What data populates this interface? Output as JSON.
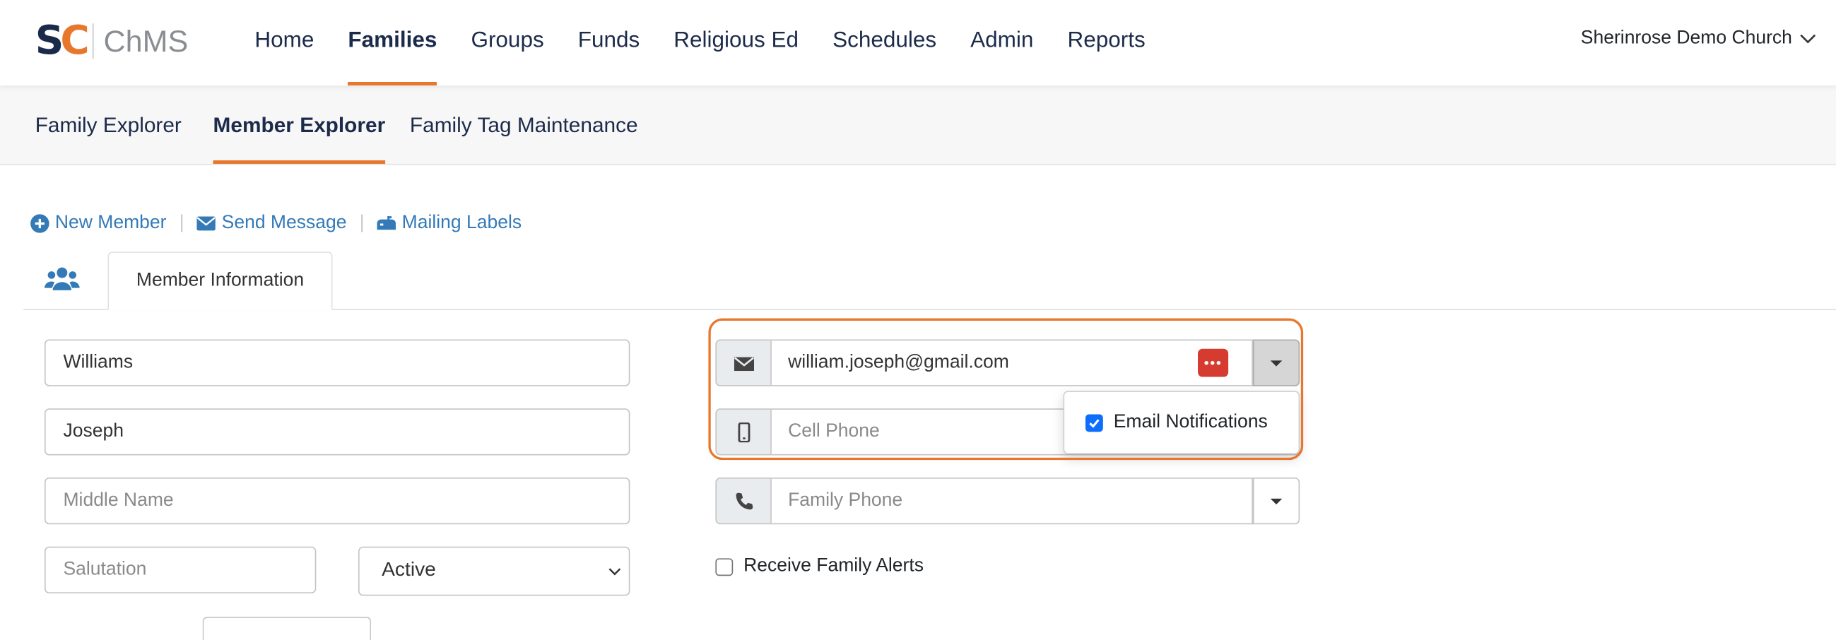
{
  "app": {
    "logo_text": "ChMS",
    "logo_mark": {
      "letter1": "S",
      "letter2": "C"
    },
    "brand_colors": {
      "navy": "#1b2a4a",
      "orange": "#e8772e"
    }
  },
  "main_nav": {
    "items": [
      {
        "label": "Home"
      },
      {
        "label": "Families",
        "active": true
      },
      {
        "label": "Groups"
      },
      {
        "label": "Funds"
      },
      {
        "label": "Religious Ed"
      },
      {
        "label": "Schedules"
      },
      {
        "label": "Admin"
      },
      {
        "label": "Reports"
      }
    ],
    "church_name": "Sherinrose Demo Church",
    "church_icon": "chevron-down-icon"
  },
  "sub_nav": {
    "items": [
      {
        "label": "Family Explorer"
      },
      {
        "label": "Member Explorer",
        "active": true
      },
      {
        "label": "Family Tag Maintenance"
      }
    ]
  },
  "actions": {
    "new_member": "New Member",
    "send_message": "Send Message",
    "mailing_labels": "Mailing Labels",
    "separator": "|"
  },
  "tabs": {
    "family_icon": "users-icon",
    "member_information": "Member Information"
  },
  "form": {
    "last_name": {
      "value": "Williams"
    },
    "first_name": {
      "value": "Joseph"
    },
    "middle_name": {
      "placeholder": "Middle Name"
    },
    "salutation": {
      "placeholder": "Salutation"
    },
    "status": {
      "selected": "Active"
    },
    "email": {
      "value": "william.joseph@gmail.com",
      "icon": "envelope-icon"
    },
    "cell_phone": {
      "placeholder": "Cell Phone",
      "icon": "mobile-icon"
    },
    "family_phone": {
      "placeholder": "Family Phone",
      "icon": "phone-icon"
    },
    "email_menu": {
      "option_label": "Email Notifications",
      "checked": true
    },
    "receive_family_alerts": {
      "label": "Receive Family Alerts",
      "checked": false
    }
  },
  "annotation": {
    "highlight_color": "#e8772e"
  }
}
